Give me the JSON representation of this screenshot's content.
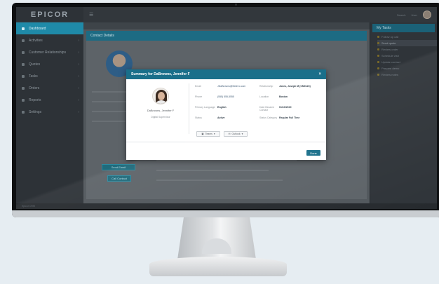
{
  "app": {
    "brand": "EPICOR"
  },
  "sidebar": {
    "items": [
      {
        "label": "Dashboard",
        "active": true
      },
      {
        "label": "Activities"
      },
      {
        "label": "Customer Relationships"
      },
      {
        "label": "Quotes"
      },
      {
        "label": "Tasks"
      },
      {
        "label": "Orders"
      },
      {
        "label": "Reports"
      },
      {
        "label": "Settings"
      }
    ]
  },
  "topbar": {
    "menu_icon": "hamburger-icon",
    "search_hint": "Search",
    "user_label": "User"
  },
  "main": {
    "card_title": "Contact Details",
    "buttons": [
      "Send Email",
      "Call Contact"
    ]
  },
  "right_panel": {
    "title": "My Tasks",
    "items": [
      "Follow up call",
      "Send quote",
      "Review order",
      "Schedule visit",
      "Update contact",
      "Prepare demo",
      "Review notes"
    ]
  },
  "modal": {
    "title": "Summary for DaBrowns, Jennifer F",
    "close_icon": "close-icon",
    "profile": {
      "name": "DaBrowns, Jennifer F",
      "subtitle": "Digital Supervisor"
    },
    "fields_left": [
      {
        "label": "Email",
        "value": "JDaBrowns@MedCo.com"
      },
      {
        "label": "Phone",
        "value": "(555) 555-5555"
      },
      {
        "label": "Primary Language",
        "value": "English"
      },
      {
        "label": "Status",
        "value": "Active"
      }
    ],
    "fields_right": [
      {
        "label": "Relationship",
        "value": "Jones, Joseph M (CM0123)"
      },
      {
        "label": "Location",
        "value": "Boston"
      },
      {
        "label": "Date Became Contact",
        "value": "01/10/2020"
      },
      {
        "label": "Status Category",
        "value": "Regular Full Time"
      }
    ],
    "actions": [
      {
        "label": "Teams",
        "icon": "teams-icon"
      },
      {
        "label": "Outlook",
        "icon": "outlook-icon"
      }
    ],
    "ok_label": "Done"
  },
  "status_bar": {
    "text": "Epicor CRM"
  }
}
